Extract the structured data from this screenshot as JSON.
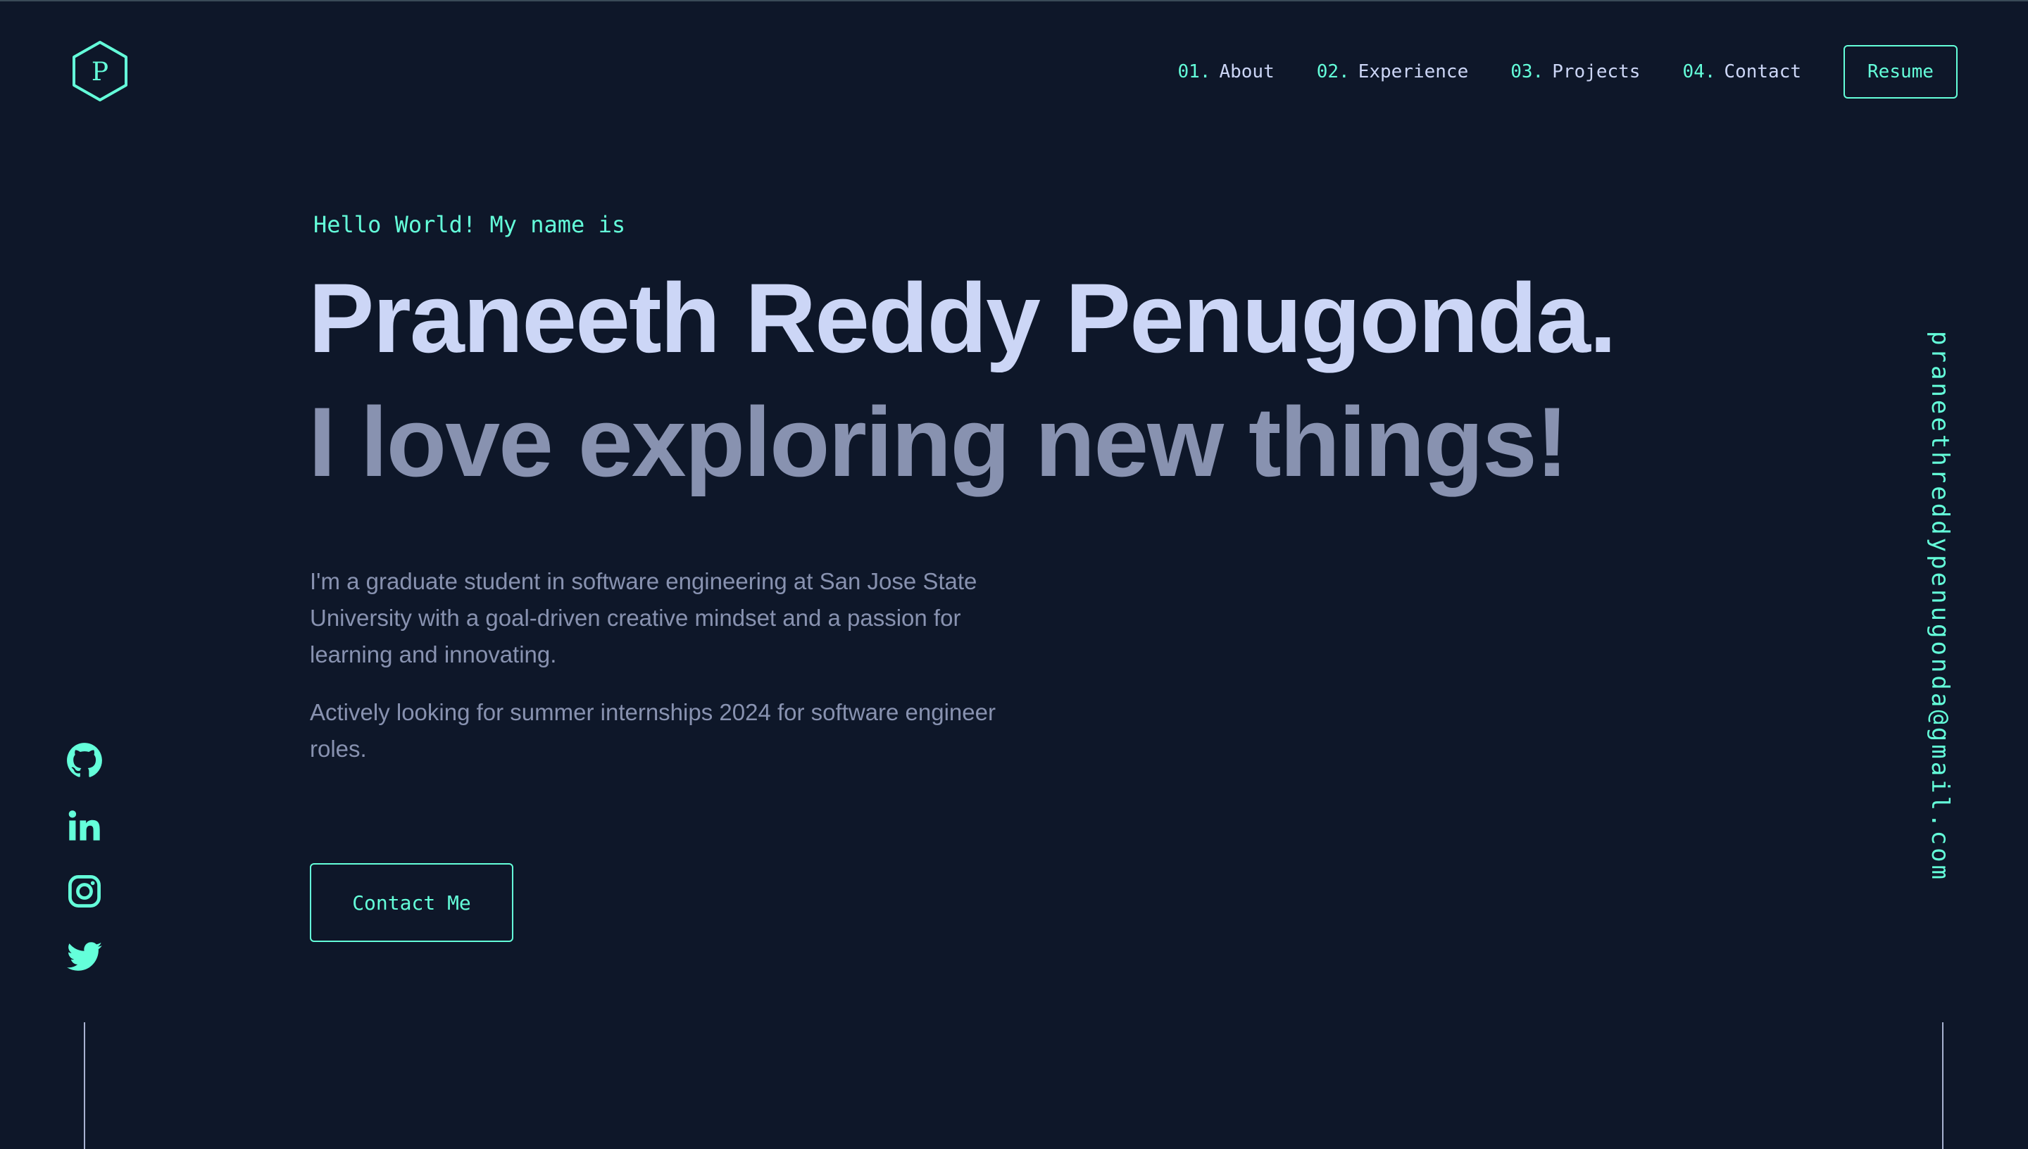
{
  "theme": {
    "background": "#0e1729",
    "accent": "#64ffda",
    "heading": "#ccd6f6",
    "muted": "#8892b0"
  },
  "header": {
    "logo_letter": "P",
    "nav": [
      {
        "number": "01.",
        "label": "About"
      },
      {
        "number": "02.",
        "label": "Experience"
      },
      {
        "number": "03.",
        "label": "Projects"
      },
      {
        "number": "04.",
        "label": "Contact"
      }
    ],
    "resume_label": "Resume"
  },
  "hero": {
    "greeting": "Hello World! My name is",
    "name": "Praneeth Reddy Penugonda.",
    "tagline": "I love exploring new things!",
    "bio": [
      "I'm a graduate student in software engineering at San Jose State University with a goal-driven creative mindset and a passion for learning and innovating.",
      "Actively looking for summer internships 2024 for software engineer roles."
    ],
    "contact_label": "Contact Me"
  },
  "sidebar": {
    "socials": [
      "github-icon",
      "linkedin-icon",
      "instagram-icon",
      "twitter-icon"
    ],
    "email": "praneethreddypenugonda@gmail.com"
  }
}
